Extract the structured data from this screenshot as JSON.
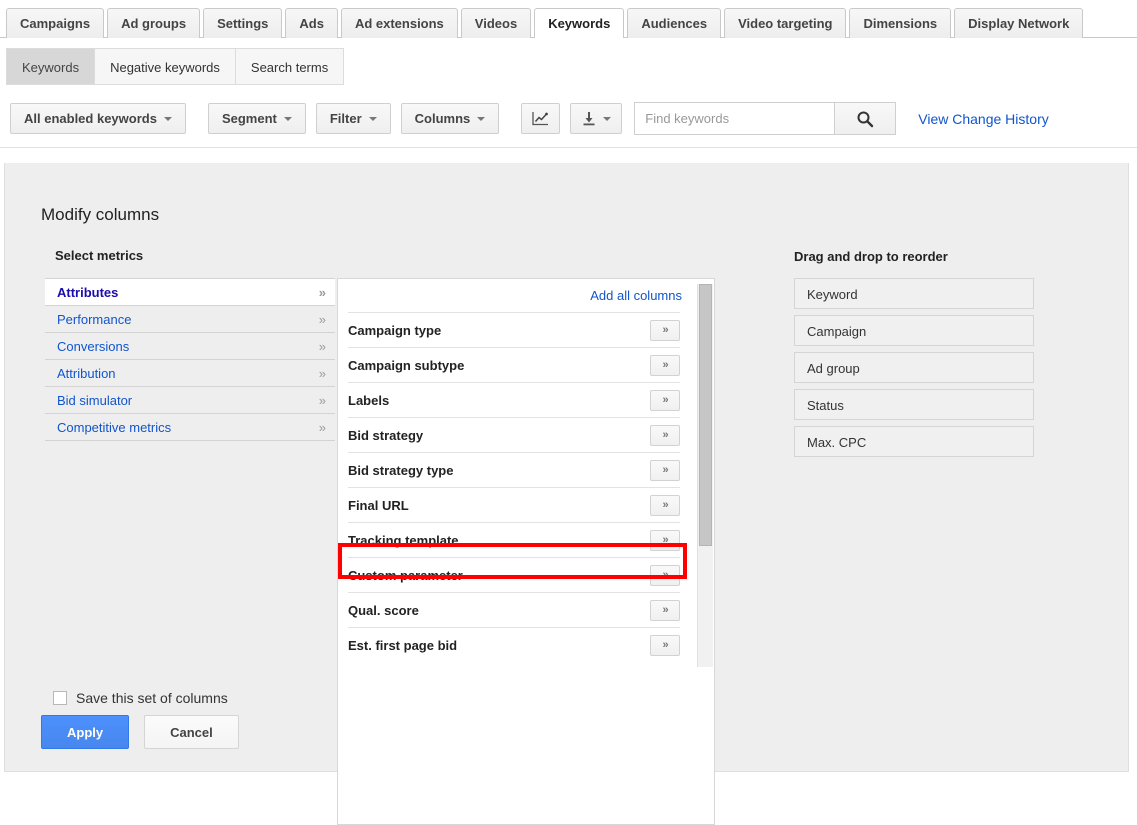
{
  "tabs": [
    {
      "label": "Campaigns",
      "selected": false
    },
    {
      "label": "Ad groups",
      "selected": false
    },
    {
      "label": "Settings",
      "selected": false
    },
    {
      "label": "Ads",
      "selected": false
    },
    {
      "label": "Ad extensions",
      "selected": false
    },
    {
      "label": "Videos",
      "selected": false
    },
    {
      "label": "Keywords",
      "selected": true
    },
    {
      "label": "Audiences",
      "selected": false
    },
    {
      "label": "Video targeting",
      "selected": false
    },
    {
      "label": "Dimensions",
      "selected": false
    },
    {
      "label": "Display Network",
      "selected": false
    }
  ],
  "subtabs": [
    {
      "label": "Keywords",
      "selected": true
    },
    {
      "label": "Negative keywords",
      "selected": false
    },
    {
      "label": "Search terms",
      "selected": false
    }
  ],
  "toolbar": {
    "filter_all": "All enabled keywords",
    "segment": "Segment",
    "filter": "Filter",
    "columns": "Columns",
    "chart_icon": "line-chart-icon",
    "download_icon": "download-icon",
    "search_placeholder": "Find keywords",
    "search_value": "",
    "search_icon": "search-icon",
    "change_history": "View Change History"
  },
  "panel": {
    "title": "Modify columns",
    "select_metrics_label": "Select metrics",
    "reorder_label": "Drag and drop to reorder",
    "add_all_label": "Add all columns",
    "categories": [
      {
        "label": "Attributes",
        "selected": true
      },
      {
        "label": "Performance",
        "selected": false
      },
      {
        "label": "Conversions",
        "selected": false
      },
      {
        "label": "Attribution",
        "selected": false
      },
      {
        "label": "Bid simulator",
        "selected": false
      },
      {
        "label": "Competitive metrics",
        "selected": false
      }
    ],
    "columns": [
      {
        "label": "Campaign type",
        "highlighted": false
      },
      {
        "label": "Campaign subtype",
        "highlighted": false
      },
      {
        "label": "Labels",
        "highlighted": true
      },
      {
        "label": "Bid strategy",
        "highlighted": false
      },
      {
        "label": "Bid strategy type",
        "highlighted": false
      },
      {
        "label": "Final URL",
        "highlighted": false
      },
      {
        "label": "Tracking template",
        "highlighted": false
      },
      {
        "label": "Custom parameter",
        "highlighted": false
      },
      {
        "label": "Qual. score",
        "highlighted": false
      },
      {
        "label": "Est. first page bid",
        "highlighted": false
      }
    ],
    "add_button_glyph": "»",
    "chevron_glyph": "»",
    "reorder_items": [
      {
        "label": "Keyword"
      },
      {
        "label": "Campaign"
      },
      {
        "label": "Ad group"
      },
      {
        "label": "Status"
      },
      {
        "label": "Max. CPC"
      }
    ],
    "save_set_label": "Save this set of columns",
    "save_set_checked": false,
    "apply_label": "Apply",
    "cancel_label": "Cancel"
  },
  "colors": {
    "highlight": "#ff0000",
    "primary_button": "#4d90fe",
    "link": "#1155cc",
    "panel_background": "#eeeeee"
  }
}
